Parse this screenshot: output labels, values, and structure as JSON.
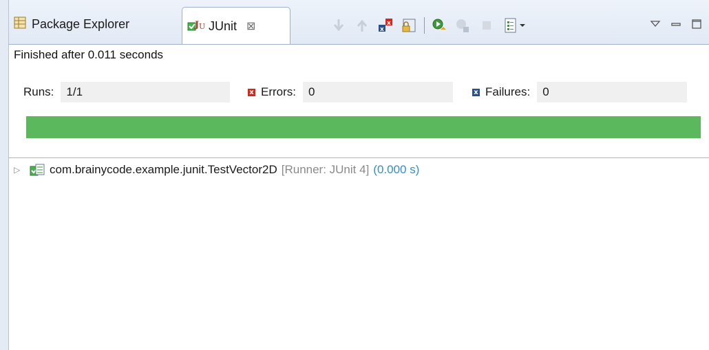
{
  "tabs": {
    "package_explorer": "Package Explorer",
    "junit": "JUnit",
    "close_glyph": "⊠"
  },
  "status": "Finished after 0.011 seconds",
  "counts": {
    "runs_label": "Runs:",
    "runs_value": "1/1",
    "errors_label": "Errors:",
    "errors_value": "0",
    "failures_label": "Failures:",
    "failures_value": "0"
  },
  "progress": {
    "fraction": 1.0,
    "color": "#5cb85c"
  },
  "tree": {
    "suite": "com.brainycode.example.junit.TestVector2D",
    "runner": "[Runner: JUnit 4]",
    "time": "(0.000 s)"
  },
  "colors": {
    "error_red": "#d9261c",
    "failure_blue": "#2a4f8f",
    "pass_green": "#5cb85c"
  }
}
